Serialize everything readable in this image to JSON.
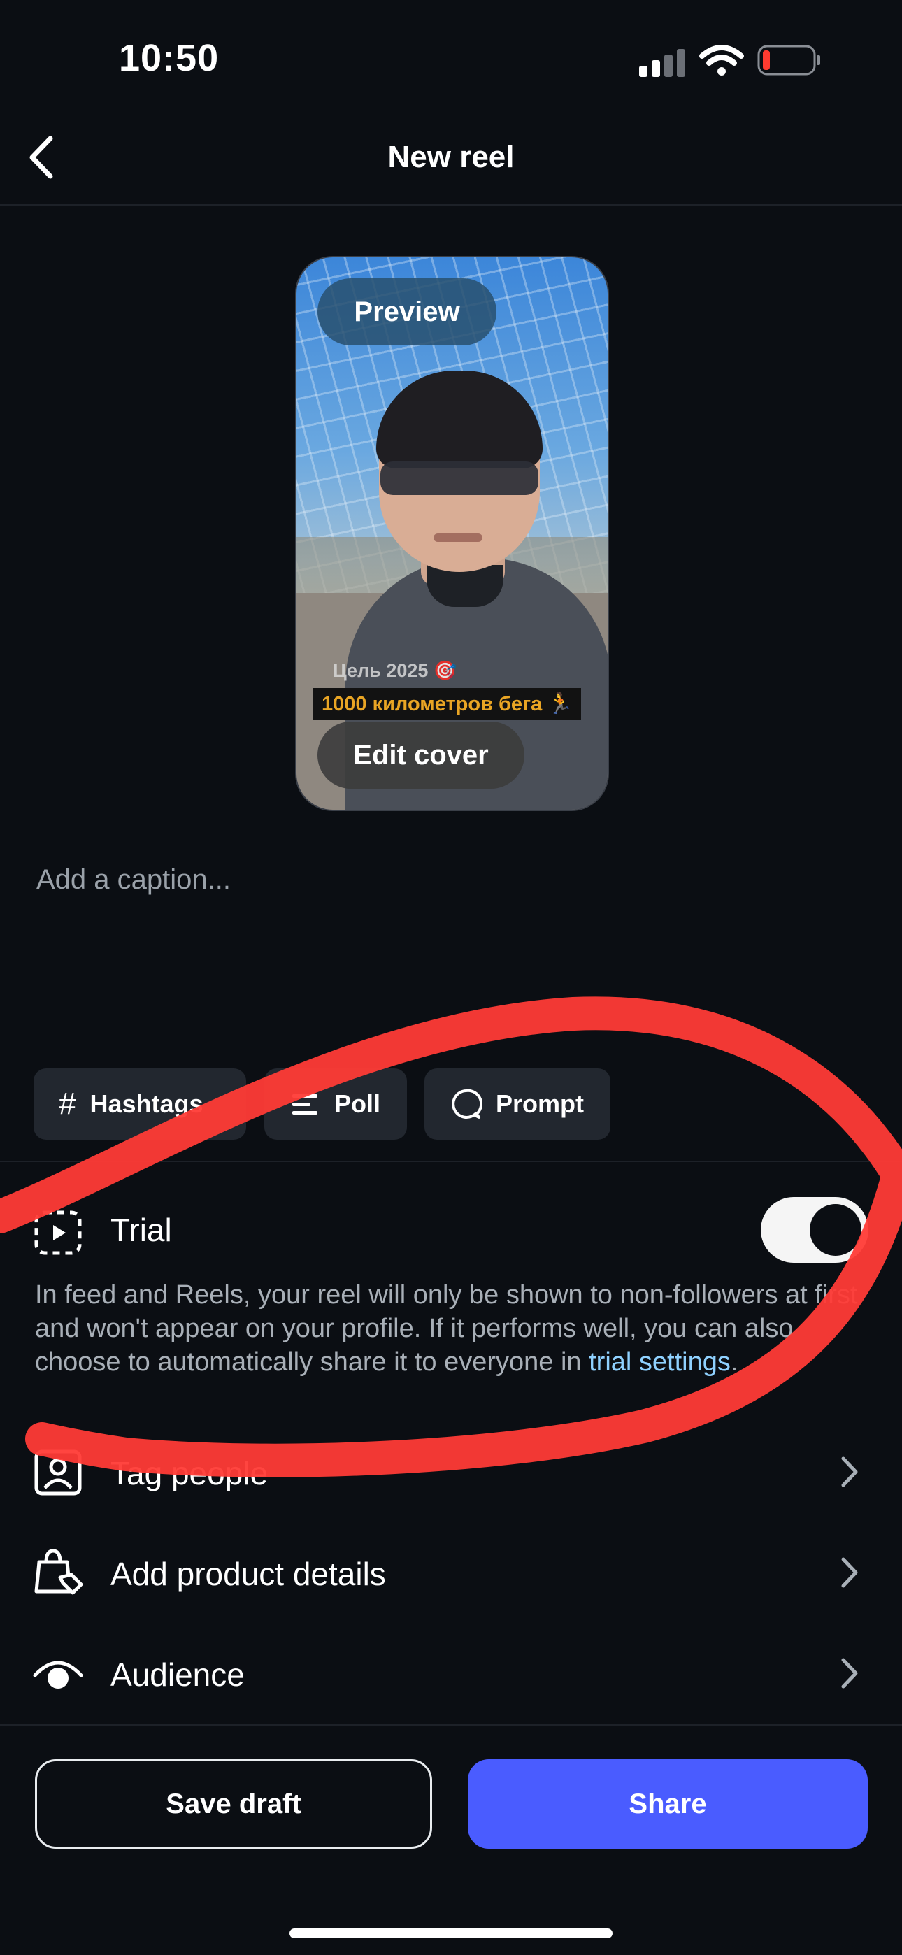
{
  "status_bar": {
    "time": "10:50"
  },
  "header": {
    "title": "New reel"
  },
  "preview": {
    "preview_label": "Preview",
    "overlay_line1": "Цель 2025 🎯",
    "overlay_line2": "1000 километров бега 🏃",
    "edit_cover_label": "Edit cover"
  },
  "caption": {
    "placeholder": "Add a caption..."
  },
  "chips": [
    {
      "label": "Hashtags",
      "icon": "hash-icon"
    },
    {
      "label": "Poll",
      "icon": "poll-icon"
    },
    {
      "label": "Prompt",
      "icon": "prompt-bubble-icon"
    }
  ],
  "trial": {
    "label": "Trial",
    "enabled": true,
    "description": "In feed and Reels, your reel will only be shown to non-followers at first and won't appear on your profile. If it performs well, you can also choose to automatically share it to everyone in ",
    "link": "trial settings",
    "description_end": "."
  },
  "rows": [
    {
      "label": "Tag people",
      "icon": "tag-person-icon"
    },
    {
      "label": "Add product details",
      "icon": "shopping-bag-tag-icon"
    },
    {
      "label": "Audience",
      "icon": "eye-icon"
    }
  ],
  "footer": {
    "save_label": "Save draft",
    "share_label": "Share"
  },
  "colors": {
    "background": "#0b0e13",
    "share_button": "#4a5cff",
    "link": "#8fd1ff",
    "scribble": "#ff3b36"
  }
}
